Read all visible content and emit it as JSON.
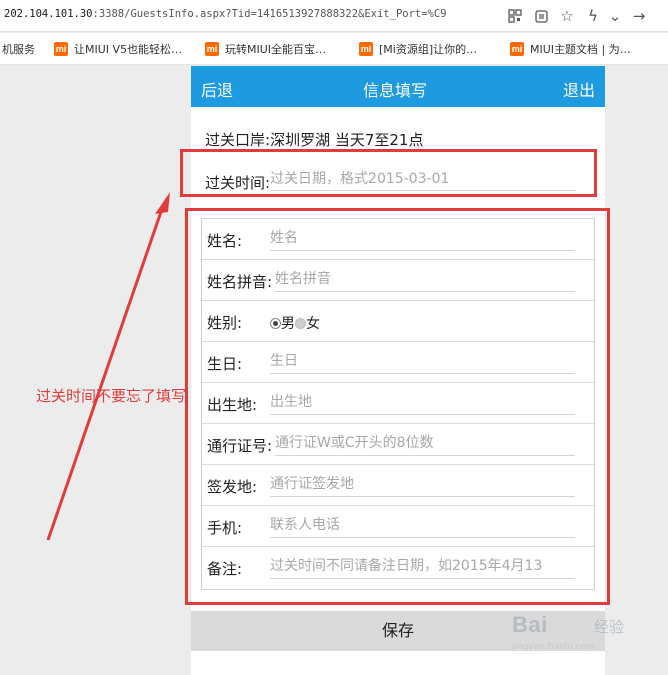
{
  "browser": {
    "url_host": "202.104.101.30",
    "url_rest": ":3388/GuestsInfo.aspx?Tid=1416513927888322&Exit_Port=%C9",
    "bookmarks": [
      "机服务",
      "让MIUI V5也能轻松…",
      "玩转MIUI全能百宝…",
      "[Mi资源组]让你的…",
      "MIUI主题文档 | 为…"
    ],
    "bookmark_icon_text": "mi"
  },
  "nav": {
    "back": "后退",
    "title": "信息填写",
    "exit": "退出"
  },
  "crossing": {
    "label": "过关口岸:",
    "value": "深圳罗湖 当天7至21点"
  },
  "time": {
    "label": "过关时间:",
    "placeholder": "过关日期，格式2015-03-01"
  },
  "form": {
    "name": {
      "label": "姓名:",
      "placeholder": "姓名"
    },
    "pinyin": {
      "label": "姓名拼音:",
      "placeholder": "姓名拼音"
    },
    "gender": {
      "label": "姓别:",
      "male": "男",
      "female": "女",
      "selected": "男"
    },
    "birthday": {
      "label": "生日:",
      "placeholder": "生日"
    },
    "birthplace": {
      "label": "出生地:",
      "placeholder": "出生地"
    },
    "permit": {
      "label": "通行证号:",
      "placeholder": "通行证W或C开头的8位数"
    },
    "issue_place": {
      "label": "签发地:",
      "placeholder": "通行证签发地"
    },
    "phone": {
      "label": "手机:",
      "placeholder": "联系人电话"
    },
    "remark": {
      "label": "备注:",
      "placeholder": "过关时间不同请备注日期，如2015年4月13"
    }
  },
  "save_label": "保存",
  "annotation": {
    "note": "过关时间不要忘了填写",
    "color": "#e23b3b"
  },
  "watermark": {
    "brand": "Bai",
    "brand2": "经验",
    "sub": "jingyan.baidu.com"
  },
  "colors": {
    "nav_bg": "#1e9ae0",
    "annotation": "#e23b3b",
    "save_bg": "#dadada"
  }
}
